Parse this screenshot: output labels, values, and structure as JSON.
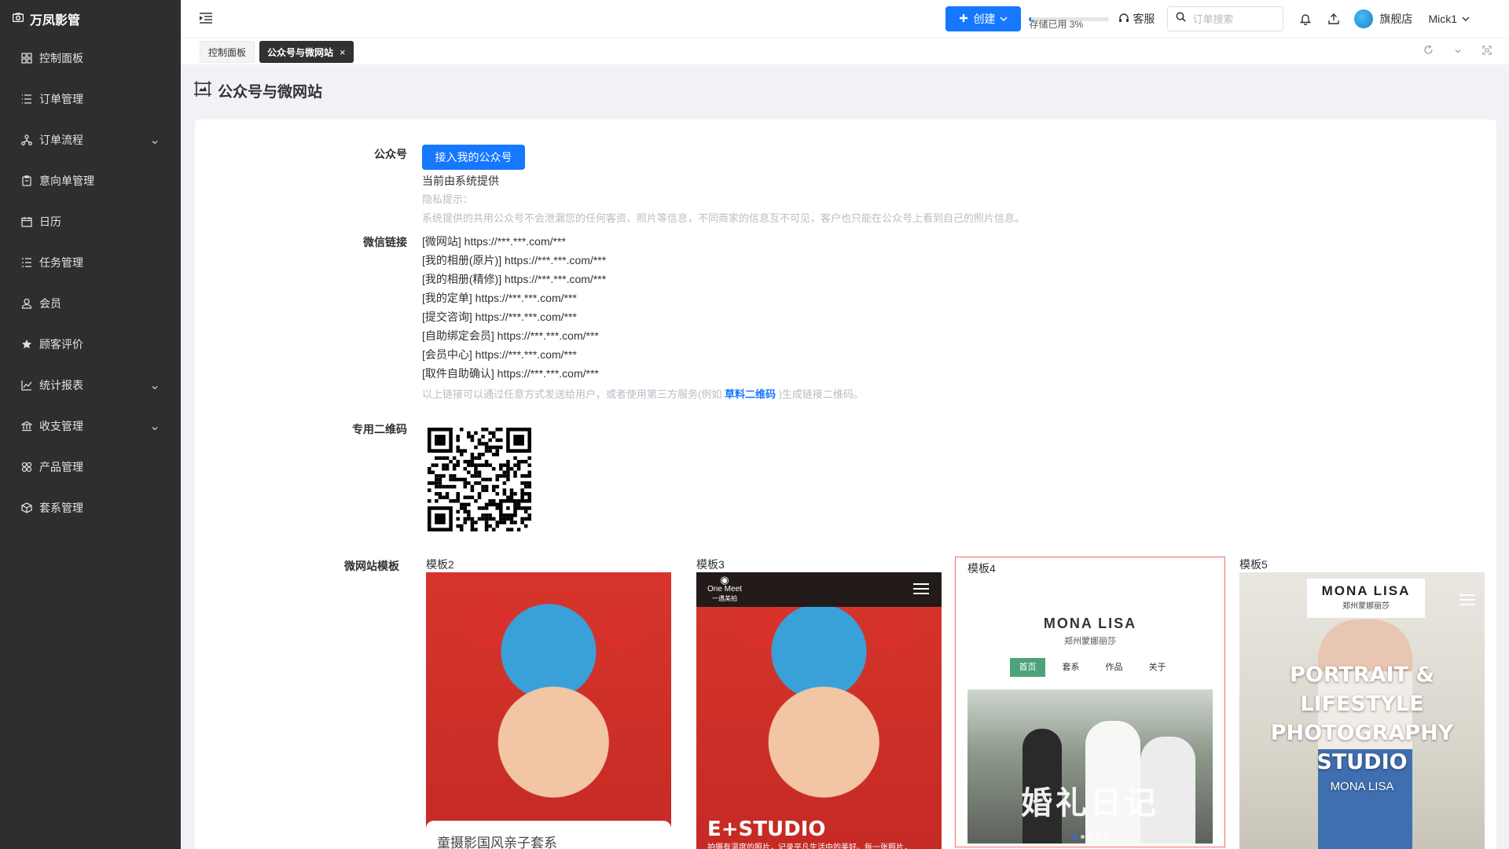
{
  "app": {
    "brand": "万凤影管"
  },
  "sidebar": {
    "items": [
      {
        "label": "控制面板",
        "icon": "grid-icon",
        "expandable": false
      },
      {
        "label": "订单管理",
        "icon": "list-icon",
        "expandable": false
      },
      {
        "label": "订单流程",
        "icon": "flow-icon",
        "expandable": true
      },
      {
        "label": "意向单管理",
        "icon": "clipboard-icon",
        "expandable": false
      },
      {
        "label": "日历",
        "icon": "calendar-icon",
        "expandable": false
      },
      {
        "label": "任务管理",
        "icon": "task-list-icon",
        "expandable": false
      },
      {
        "label": "会员",
        "icon": "user-icon",
        "expandable": false
      },
      {
        "label": "顾客评价",
        "icon": "star-icon",
        "expandable": false
      },
      {
        "label": "统计报表",
        "icon": "chart-icon",
        "expandable": true
      },
      {
        "label": "收支管理",
        "icon": "bank-icon",
        "expandable": true
      },
      {
        "label": "产品管理",
        "icon": "product-icon",
        "expandable": false
      },
      {
        "label": "套系管理",
        "icon": "package-icon",
        "expandable": false
      }
    ]
  },
  "header": {
    "create_label": "创建",
    "storage_label": "存储已用 3%",
    "storage_percent": 3,
    "service_label": "客服",
    "search_placeholder": "订单搜索",
    "store_label": "旗舰店",
    "user_label": "Mick1"
  },
  "tabs": [
    {
      "label": "控制面板",
      "active": false
    },
    {
      "label": "公众号与微网站",
      "active": true,
      "close": "×"
    }
  ],
  "page": {
    "title": "公众号与微网站",
    "official_account": {
      "label": "公众号",
      "button": "接入我的公众号",
      "status": "当前由系统提供",
      "privacy_title": "隐私提示：",
      "privacy_text": "系统提供的共用公众号不会泄漏您的任何客资、照片等信息，不同商家的信息互不可见，客户也只能在公众号上看到自己的照片信息。"
    },
    "wechat_links": {
      "label": "微信链接",
      "items": [
        "[微网站] https://***.***.com/***",
        "[我的相册(原片)] https://***.***.com/***",
        "[我的相册(精修)] https://***.***.com/***",
        "[我的定单] https://***.***.com/***",
        "[提交咨询] https://***.***.com/***",
        "[自助绑定会员] https://***.***.com/***",
        "[会员中心] https://***.***.com/***",
        "[取件自助确认] https://***.***.com/***"
      ],
      "note_before": "以上链接可以通过任意方式发送给用户，或者使用第三方服务(例如 ",
      "note_link": "草料二维码",
      "note_after": " )生成链接二维码。"
    },
    "qr": {
      "label": "专用二维码"
    },
    "templates": {
      "label": "微网站模板",
      "items": [
        {
          "name": "模板2",
          "caption": "童摄影国风亲子套系"
        },
        {
          "name": "模板3",
          "logo_line1": "One Meet",
          "logo_line2": "一遇美拍",
          "studio": "E+STUDIO",
          "tagline": "拍摄有温度的照片，记录平凡生活中的美好。每一张照片，"
        },
        {
          "name": "模板4",
          "selected": true,
          "brand": "MONA LISA",
          "brand_sub": "郑州蒙娜丽莎",
          "nav": [
            "首页",
            "套系",
            "作品",
            "关于"
          ],
          "banner": "婚礼日记"
        },
        {
          "name": "模板5",
          "brand": "MONA LISA",
          "brand_sub": "郑州蒙娜丽莎",
          "headline_1": "PORTRAIT &",
          "headline_2": "LIFESTYLE",
          "headline_3": "PHOTOGRAPHY",
          "headline_4": "STUDIO",
          "subname": "MONA LISA"
        }
      ]
    }
  },
  "colors": {
    "primary": "#1677ff",
    "sidebar_bg": "#2e2e30",
    "selected_border": "#f56c6c",
    "template_accent": "#4ca37a"
  }
}
